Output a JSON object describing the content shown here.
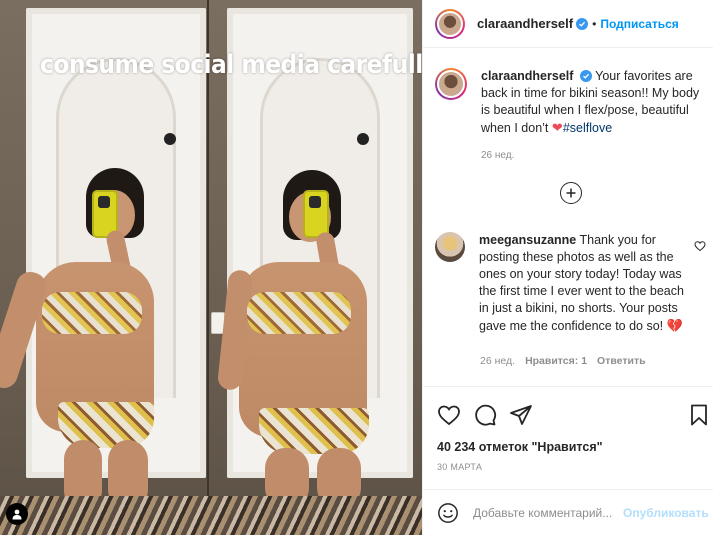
{
  "photo": {
    "overlay_text": "consume social media carefully"
  },
  "header": {
    "username": "claraandherself",
    "separator": "•",
    "follow_label": "Подписаться"
  },
  "caption": {
    "username": "claraandherself",
    "text": "Your favorites are back in time for bikini season!! My body is beautiful when I flex/pose, beautiful when I don’t",
    "heart": "❤",
    "hashtag": "#selflove",
    "time": "26 нед."
  },
  "comment": {
    "username": "meegansuzanne",
    "text": "Thank you for posting these photos as well as the ones on your story today! Today was the first time I ever went to the beach in just a bikini, no shorts. Your posts gave me the confidence to do so!",
    "emoji": "💔",
    "time": "26 нед.",
    "likes": "Нравится: 1",
    "reply_label": "Ответить"
  },
  "actions": {
    "likes_count": "40 234 отметок \"Нравится\"",
    "date": "30 МАРТА"
  },
  "comment_bar": {
    "placeholder": "Добавьте комментарий...",
    "post_label": "Опубликовать"
  },
  "colors": {
    "link_blue": "#0095f6",
    "hashtag_blue": "#00376b",
    "verified_blue": "#3897f0",
    "heart_red": "#ed4956",
    "muted_gray": "#8e8e8e"
  },
  "icons": {
    "verified": "verified-badge-icon",
    "more_comments": "plus-circle-icon",
    "comment_like": "heart-outline-icon",
    "like": "heart-outline-icon",
    "comment": "speech-bubble-icon",
    "share": "paper-plane-icon",
    "save": "bookmark-icon",
    "emoji": "smiley-icon",
    "tag": "user-tag-icon"
  }
}
